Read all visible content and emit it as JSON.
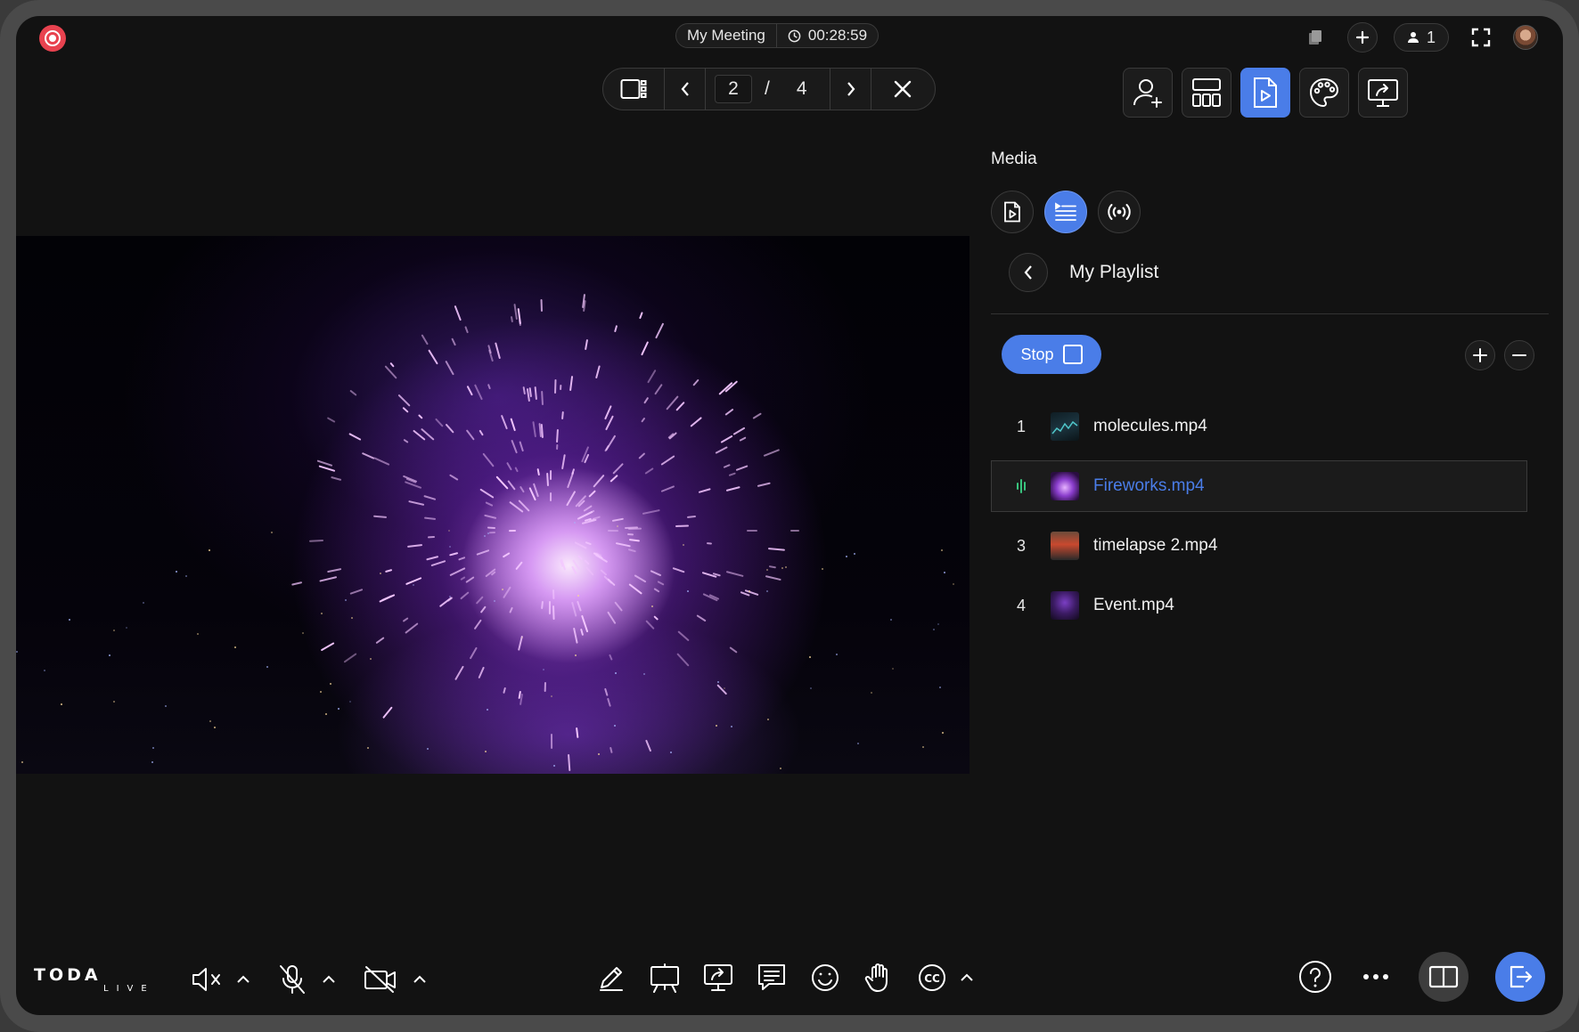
{
  "meeting": {
    "title": "My Meeting",
    "timer": "00:28:59"
  },
  "participants": {
    "count": "1"
  },
  "pager": {
    "current": "2",
    "separator": "/",
    "total": "4"
  },
  "media_panel": {
    "title": "Media",
    "playlist_title": "My Playlist",
    "stop_label": "Stop",
    "items": [
      {
        "num": "1",
        "name": "molecules.mp4",
        "playing": false
      },
      {
        "num": "",
        "name": "Fireworks.mp4",
        "playing": true
      },
      {
        "num": "3",
        "name": "timelapse 2.mp4",
        "playing": false
      },
      {
        "num": "4",
        "name": "Event.mp4",
        "playing": false
      }
    ]
  },
  "brand": {
    "logo_main": "TODA",
    "logo_sub": "LIVE"
  },
  "colors": {
    "accent": "#4a7de8",
    "record": "#e8424f",
    "playing_indicator": "#39c47e",
    "background": "#121212"
  },
  "icons": {
    "top_right": [
      "copy-icon",
      "plus-icon",
      "person-icon",
      "fullscreen-icon",
      "avatar"
    ],
    "panel_tools": [
      "add-user-icon",
      "layout-icon",
      "media-icon",
      "palette-icon",
      "share-screen-icon"
    ],
    "media_tabs": [
      "file-video-icon",
      "playlist-icon",
      "broadcast-icon"
    ],
    "bottom_left": [
      "speaker-muted-icon",
      "mic-muted-icon",
      "camera-off-icon"
    ],
    "bottom_center": [
      "pencil-icon",
      "whiteboard-icon",
      "share-screen-icon",
      "chat-icon",
      "emoji-icon",
      "raise-hand-icon",
      "captions-icon"
    ],
    "bottom_right": [
      "help-icon",
      "more-icon",
      "layout-toggle-icon",
      "leave-icon"
    ]
  }
}
